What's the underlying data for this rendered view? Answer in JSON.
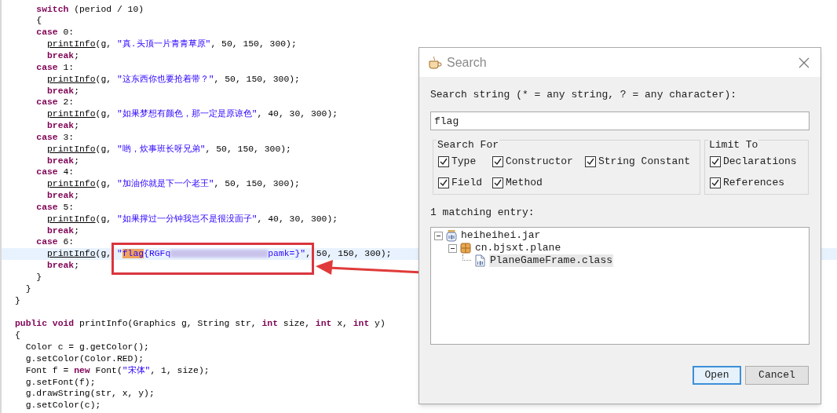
{
  "editor": {
    "lines": [
      {
        "current": false,
        "tokens": [
          {
            "kind": "kw",
            "text": "    switch"
          },
          {
            "kind": "plain",
            "text": " (period / 10)"
          }
        ]
      },
      {
        "current": false,
        "tokens": [
          {
            "kind": "plain",
            "text": "    {"
          }
        ]
      },
      {
        "current": false,
        "tokens": [
          {
            "kind": "kw",
            "text": "    case"
          },
          {
            "kind": "plain",
            "text": " 0:"
          }
        ]
      },
      {
        "current": false,
        "tokens": [
          {
            "kind": "call",
            "text": "      printInfo"
          },
          {
            "kind": "plain",
            "text": "(g, "
          },
          {
            "kind": "str",
            "text": "\"真.头顶一片青青草原\""
          },
          {
            "kind": "plain",
            "text": ", 50, 150, 300);"
          }
        ]
      },
      {
        "current": false,
        "tokens": [
          {
            "kind": "kw",
            "text": "      break"
          },
          {
            "kind": "plain",
            "text": ";"
          }
        ]
      },
      {
        "current": false,
        "tokens": [
          {
            "kind": "kw",
            "text": "    case"
          },
          {
            "kind": "plain",
            "text": " 1:"
          }
        ]
      },
      {
        "current": false,
        "tokens": [
          {
            "kind": "call",
            "text": "      printInfo"
          },
          {
            "kind": "plain",
            "text": "(g, "
          },
          {
            "kind": "str",
            "text": "\"这东西你也要抢着带？\""
          },
          {
            "kind": "plain",
            "text": ", 50, 150, 300);"
          }
        ]
      },
      {
        "current": false,
        "tokens": [
          {
            "kind": "kw",
            "text": "      break"
          },
          {
            "kind": "plain",
            "text": ";"
          }
        ]
      },
      {
        "current": false,
        "tokens": [
          {
            "kind": "kw",
            "text": "    case"
          },
          {
            "kind": "plain",
            "text": " 2:"
          }
        ]
      },
      {
        "current": false,
        "tokens": [
          {
            "kind": "call",
            "text": "      printInfo"
          },
          {
            "kind": "plain",
            "text": "(g, "
          },
          {
            "kind": "str",
            "text": "\"如果梦想有颜色，那一定是原谅色\""
          },
          {
            "kind": "plain",
            "text": ", 40, 30, 300);"
          }
        ]
      },
      {
        "current": false,
        "tokens": [
          {
            "kind": "kw",
            "text": "      break"
          },
          {
            "kind": "plain",
            "text": ";"
          }
        ]
      },
      {
        "current": false,
        "tokens": [
          {
            "kind": "kw",
            "text": "    case"
          },
          {
            "kind": "plain",
            "text": " 3:"
          }
        ]
      },
      {
        "current": false,
        "tokens": [
          {
            "kind": "call",
            "text": "      printInfo"
          },
          {
            "kind": "plain",
            "text": "(g, "
          },
          {
            "kind": "str",
            "text": "\"哟，炊事班长呀兄弟\""
          },
          {
            "kind": "plain",
            "text": ", 50, 150, 300);"
          }
        ]
      },
      {
        "current": false,
        "tokens": [
          {
            "kind": "kw",
            "text": "      break"
          },
          {
            "kind": "plain",
            "text": ";"
          }
        ]
      },
      {
        "current": false,
        "tokens": [
          {
            "kind": "kw",
            "text": "    case"
          },
          {
            "kind": "plain",
            "text": " 4:"
          }
        ]
      },
      {
        "current": false,
        "tokens": [
          {
            "kind": "call",
            "text": "      printInfo"
          },
          {
            "kind": "plain",
            "text": "(g, "
          },
          {
            "kind": "str",
            "text": "\"加油你就是下一个老王\""
          },
          {
            "kind": "plain",
            "text": ", 50, 150, 300);"
          }
        ]
      },
      {
        "current": false,
        "tokens": [
          {
            "kind": "kw",
            "text": "      break"
          },
          {
            "kind": "plain",
            "text": ";"
          }
        ]
      },
      {
        "current": false,
        "tokens": [
          {
            "kind": "kw",
            "text": "    case"
          },
          {
            "kind": "plain",
            "text": " 5:"
          }
        ]
      },
      {
        "current": false,
        "tokens": [
          {
            "kind": "call",
            "text": "      printInfo"
          },
          {
            "kind": "plain",
            "text": "(g, "
          },
          {
            "kind": "str",
            "text": "\"如果撑过一分钟我岂不是很没面子\""
          },
          {
            "kind": "plain",
            "text": ", 40, 30, 300);"
          }
        ]
      },
      {
        "current": false,
        "tokens": [
          {
            "kind": "kw",
            "text": "      break"
          },
          {
            "kind": "plain",
            "text": ";"
          }
        ]
      },
      {
        "current": false,
        "tokens": [
          {
            "kind": "kw",
            "text": "    case"
          },
          {
            "kind": "plain",
            "text": " 6:"
          }
        ]
      },
      {
        "current": true,
        "tokens": [
          {
            "kind": "call",
            "text": "      printInfo"
          },
          {
            "kind": "plain",
            "text": "(g, "
          },
          {
            "kind": "str",
            "text": "\""
          },
          {
            "kind": "match",
            "text": "flag"
          },
          {
            "kind": "str",
            "text": "{RGFq"
          },
          {
            "kind": "redacted"
          },
          {
            "kind": "str",
            "text": "pamk=}\""
          },
          {
            "kind": "plain",
            "text": ", 50, 150, 300);"
          }
        ]
      },
      {
        "current": false,
        "tokens": [
          {
            "kind": "kw",
            "text": "      break"
          },
          {
            "kind": "plain",
            "text": ";"
          }
        ]
      },
      {
        "current": false,
        "tokens": [
          {
            "kind": "plain",
            "text": "    }"
          }
        ]
      },
      {
        "current": false,
        "tokens": [
          {
            "kind": "plain",
            "text": "  }"
          }
        ]
      },
      {
        "current": false,
        "tokens": [
          {
            "kind": "plain",
            "text": "}"
          }
        ]
      },
      {
        "current": false,
        "space_before": true,
        "tokens": [
          {
            "kind": "kw",
            "text": "public void"
          },
          {
            "kind": "plain",
            "text": " printInfo(Graphics g, String str, "
          },
          {
            "kind": "kw",
            "text": "int"
          },
          {
            "kind": "plain",
            "text": " size, "
          },
          {
            "kind": "kw",
            "text": "int"
          },
          {
            "kind": "plain",
            "text": " x, "
          },
          {
            "kind": "kw",
            "text": "int"
          },
          {
            "kind": "plain",
            "text": " y)"
          }
        ]
      },
      {
        "current": false,
        "tokens": [
          {
            "kind": "plain",
            "text": "{"
          }
        ]
      },
      {
        "current": false,
        "tokens": [
          {
            "kind": "plain",
            "text": "  Color c = g.getColor();"
          }
        ]
      },
      {
        "current": false,
        "tokens": [
          {
            "kind": "plain",
            "text": "  g.setColor(Color.RED);"
          }
        ]
      },
      {
        "current": false,
        "tokens": [
          {
            "kind": "plain",
            "text": "  Font f = "
          },
          {
            "kind": "kw",
            "text": "new"
          },
          {
            "kind": "plain",
            "text": " Font("
          },
          {
            "kind": "str",
            "text": "\"宋体\""
          },
          {
            "kind": "plain",
            "text": ", 1, size);"
          }
        ]
      },
      {
        "current": false,
        "tokens": [
          {
            "kind": "plain",
            "text": "  g.setFont(f);"
          }
        ]
      },
      {
        "current": false,
        "tokens": [
          {
            "kind": "plain",
            "text": "  g.drawString(str, x, y);"
          }
        ]
      },
      {
        "current": false,
        "tokens": [
          {
            "kind": "plain",
            "text": "  g.setColor(c);"
          }
        ]
      }
    ]
  },
  "dialog": {
    "title": "Search",
    "search_label": "Search string (* = any string, ? = any character):",
    "search_value": "flag",
    "search_for": {
      "title": "Search For",
      "options": [
        {
          "label": "Type",
          "checked": true
        },
        {
          "label": "Constructor",
          "checked": true
        },
        {
          "label": "String Constant",
          "checked": true
        },
        {
          "label": "Field",
          "checked": true
        },
        {
          "label": "Method",
          "checked": true
        }
      ]
    },
    "limit_to": {
      "title": "Limit To",
      "options": [
        {
          "label": "Declarations",
          "checked": true
        },
        {
          "label": "References",
          "checked": true
        }
      ]
    },
    "result_label": "1 matching entry:",
    "results": [
      {
        "label": "heiheihei.jar",
        "kind": "jar",
        "expanded": true,
        "selected": false,
        "children": [
          {
            "label": "cn.bjsxt.plane",
            "kind": "package",
            "expanded": true,
            "selected": false,
            "children": [
              {
                "label": "PlaneGameFrame.class",
                "kind": "class",
                "selected": true
              }
            ]
          }
        ]
      }
    ],
    "buttons": [
      {
        "label": "Open",
        "default": true
      },
      {
        "label": "Cancel",
        "default": false
      }
    ]
  }
}
